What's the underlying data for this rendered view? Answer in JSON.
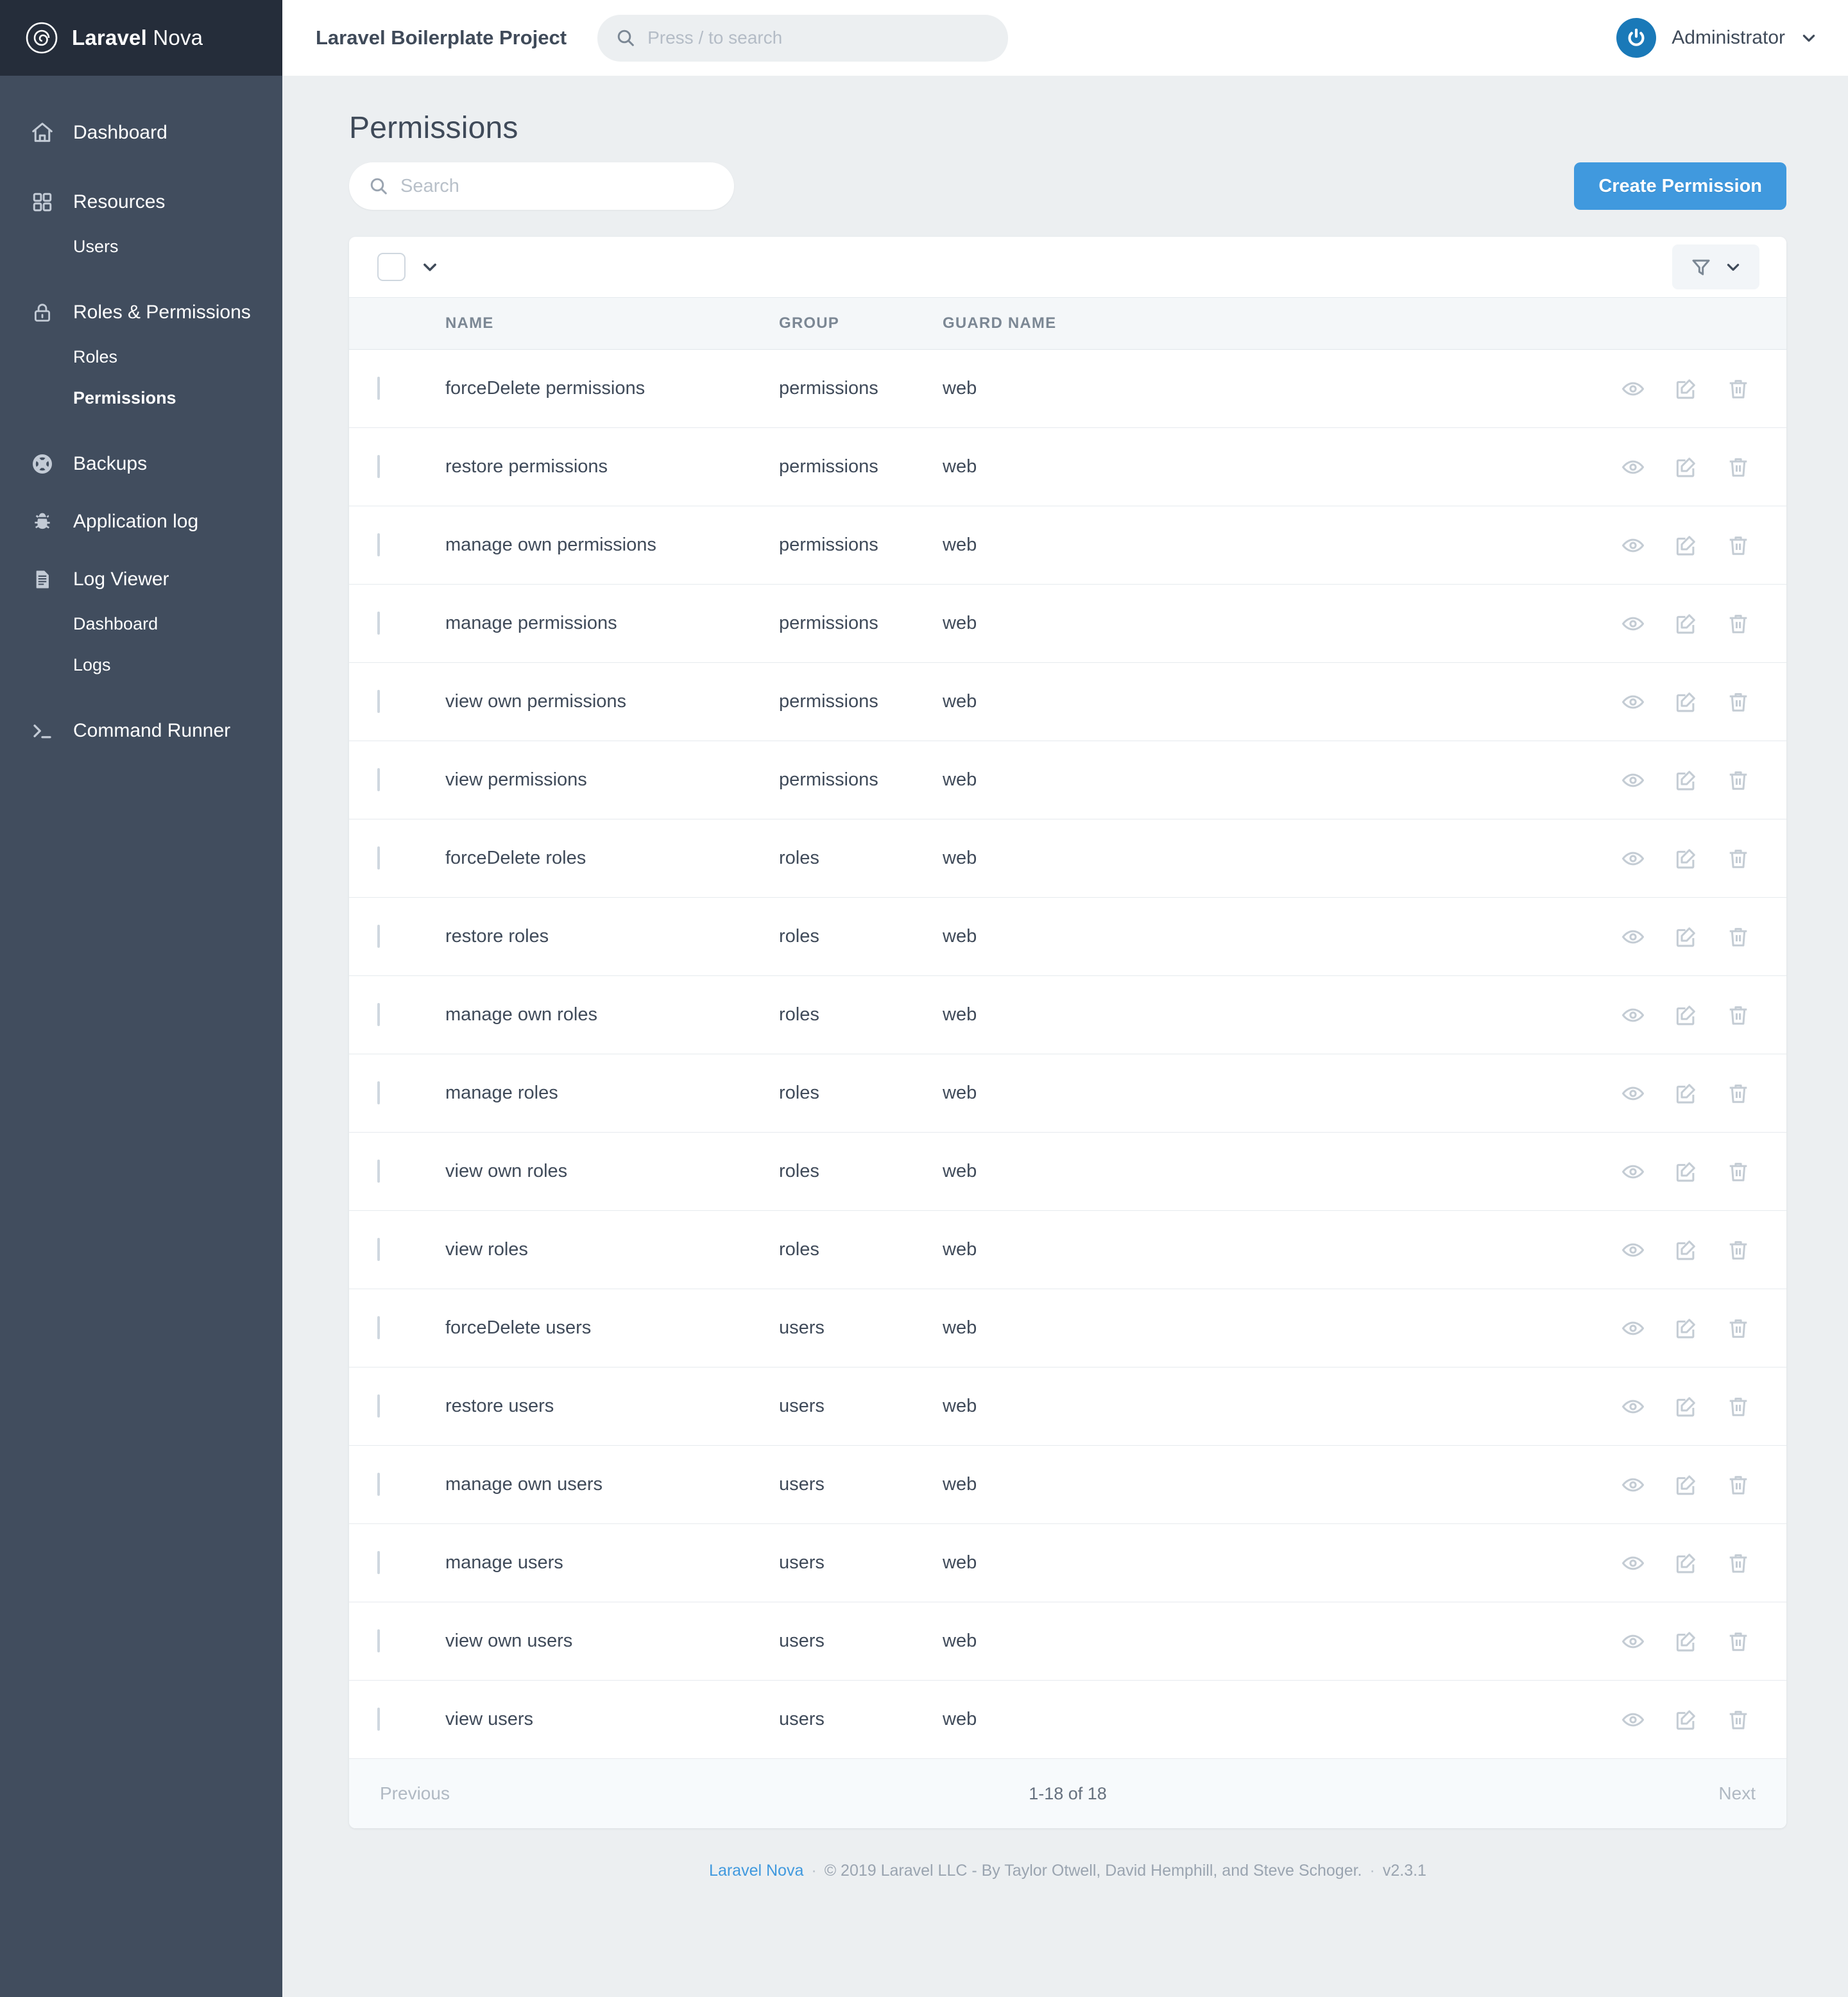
{
  "brand": {
    "name_bold": "Laravel",
    "name_light": "Nova",
    "logo_icon": "nova-spiral-logo-icon"
  },
  "topbar": {
    "project_title": "Laravel Boilerplate Project",
    "search_placeholder": "Press / to search",
    "search_value": "",
    "search_icon": "search-icon",
    "user_name": "Administrator",
    "avatar_icon": "power-avatar-icon",
    "caret_icon": "chevron-down-icon"
  },
  "sidebar": {
    "items": [
      {
        "label": "Dashboard",
        "icon": "home-icon",
        "type": "top",
        "active": false
      },
      {
        "label": "Resources",
        "icon": "grid-icon",
        "type": "top",
        "active": false
      },
      {
        "label": "Users",
        "icon": "",
        "type": "sub",
        "active": false
      },
      {
        "label": "Roles & Permissions",
        "icon": "lock-icon",
        "type": "top",
        "active": false
      },
      {
        "label": "Roles",
        "icon": "",
        "type": "sub",
        "active": false
      },
      {
        "label": "Permissions",
        "icon": "",
        "type": "sub",
        "active": true
      },
      {
        "label": "Backups",
        "icon": "lifebuoy-icon",
        "type": "top",
        "active": false
      },
      {
        "label": "Application log",
        "icon": "bug-icon",
        "type": "top",
        "active": false
      },
      {
        "label": "Log Viewer",
        "icon": "document-icon",
        "type": "top",
        "active": false
      },
      {
        "label": "Dashboard",
        "icon": "",
        "type": "sub",
        "active": false
      },
      {
        "label": "Logs",
        "icon": "",
        "type": "sub",
        "active": false
      },
      {
        "label": "Command Runner",
        "icon": "terminal-prompt-icon",
        "type": "top",
        "active": false
      }
    ]
  },
  "page": {
    "title": "Permissions",
    "search_placeholder": "Search",
    "search_value": "",
    "search_icon": "search-icon",
    "create_button": "Create Permission"
  },
  "table": {
    "select_all_checked": false,
    "select_all_caret_icon": "chevron-down-icon",
    "filter_icon": "filter-funnel-icon",
    "filter_caret_icon": "chevron-down-icon",
    "columns": [
      "NAME",
      "GROUP",
      "GUARD NAME"
    ],
    "row_actions": [
      "view-icon",
      "edit-icon",
      "delete-icon"
    ],
    "rows": [
      {
        "name": "forceDelete permissions",
        "group": "permissions",
        "guard": "web"
      },
      {
        "name": "restore permissions",
        "group": "permissions",
        "guard": "web"
      },
      {
        "name": "manage own permissions",
        "group": "permissions",
        "guard": "web"
      },
      {
        "name": "manage permissions",
        "group": "permissions",
        "guard": "web"
      },
      {
        "name": "view own permissions",
        "group": "permissions",
        "guard": "web"
      },
      {
        "name": "view permissions",
        "group": "permissions",
        "guard": "web"
      },
      {
        "name": "forceDelete roles",
        "group": "roles",
        "guard": "web"
      },
      {
        "name": "restore roles",
        "group": "roles",
        "guard": "web"
      },
      {
        "name": "manage own roles",
        "group": "roles",
        "guard": "web"
      },
      {
        "name": "manage roles",
        "group": "roles",
        "guard": "web"
      },
      {
        "name": "view own roles",
        "group": "roles",
        "guard": "web"
      },
      {
        "name": "view roles",
        "group": "roles",
        "guard": "web"
      },
      {
        "name": "forceDelete users",
        "group": "users",
        "guard": "web"
      },
      {
        "name": "restore users",
        "group": "users",
        "guard": "web"
      },
      {
        "name": "manage own users",
        "group": "users",
        "guard": "web"
      },
      {
        "name": "manage users",
        "group": "users",
        "guard": "web"
      },
      {
        "name": "view own users",
        "group": "users",
        "guard": "web"
      },
      {
        "name": "view users",
        "group": "users",
        "guard": "web"
      }
    ]
  },
  "pagination": {
    "previous": "Previous",
    "next": "Next",
    "count": "1-18 of 18"
  },
  "footer": {
    "link": "Laravel Nova",
    "copyright": "© 2019 Laravel LLC - By Taylor Otwell, David Hemphill, and Steve Schoger.",
    "version": "v2.3.1"
  },
  "colors": {
    "accent": "#4099de",
    "sidebar": "#414d5e",
    "sidebar_header": "#252d3a",
    "page_bg": "#eceff1",
    "text": "#3f4a59",
    "muted": "#7b8794"
  }
}
